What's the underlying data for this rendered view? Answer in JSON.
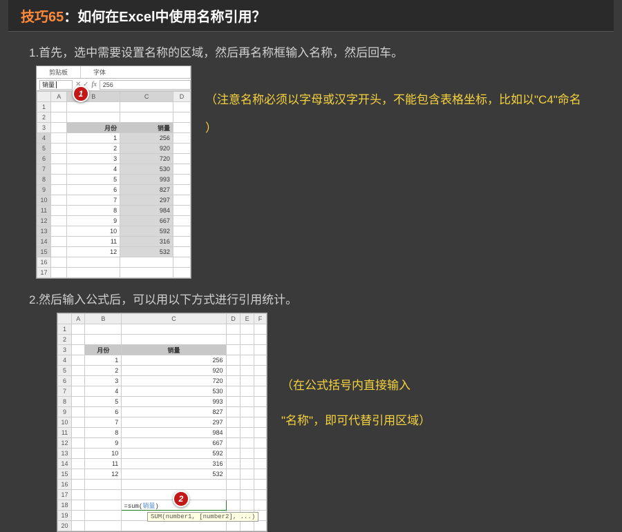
{
  "title": {
    "tip": "技巧65",
    "rest": "：如何在Excel中使用名称引用？"
  },
  "step1": "1.首先，选中需要设置名称的区域，然后再名称框输入名称，然后回车。",
  "step2": "2.然后输入公式后，可以用以下方式进行引用统计。",
  "note1": "（注意名称必须以字母或汉字开头，不能包含表格坐标，比如以\"C4\"命名 ）  ",
  "note2a": "（在公式括号内直接输入",
  "note2b": "\"名称\"，即可代替引用区域）",
  "badge1": "1",
  "badge2": "2",
  "excel": {
    "ribbon_clipboard": "剪贴板",
    "ribbon_font": "字体",
    "namebox": "销量",
    "fx": "fx",
    "fx_val": "256",
    "cols1": [
      "A",
      "B",
      "C",
      "D"
    ],
    "cols2": [
      "A",
      "B",
      "C",
      "D",
      "E",
      "F"
    ],
    "hdr_month": "月份",
    "hdr_qty": "销量",
    "rows": [
      {
        "m": "1",
        "q": "256"
      },
      {
        "m": "2",
        "q": "920"
      },
      {
        "m": "3",
        "q": "720"
      },
      {
        "m": "4",
        "q": "530"
      },
      {
        "m": "5",
        "q": "993"
      },
      {
        "m": "6",
        "q": "827"
      },
      {
        "m": "7",
        "q": "297"
      },
      {
        "m": "8",
        "q": "984"
      },
      {
        "m": "9",
        "q": "667"
      },
      {
        "m": "10",
        "q": "592"
      },
      {
        "m": "11",
        "q": "316"
      },
      {
        "m": "12",
        "q": "532"
      }
    ],
    "formula_prefix": "=sum(",
    "formula_name": "销量",
    "formula_suffix": ")",
    "tooltip": "SUM(number1, [number2], ...)"
  }
}
